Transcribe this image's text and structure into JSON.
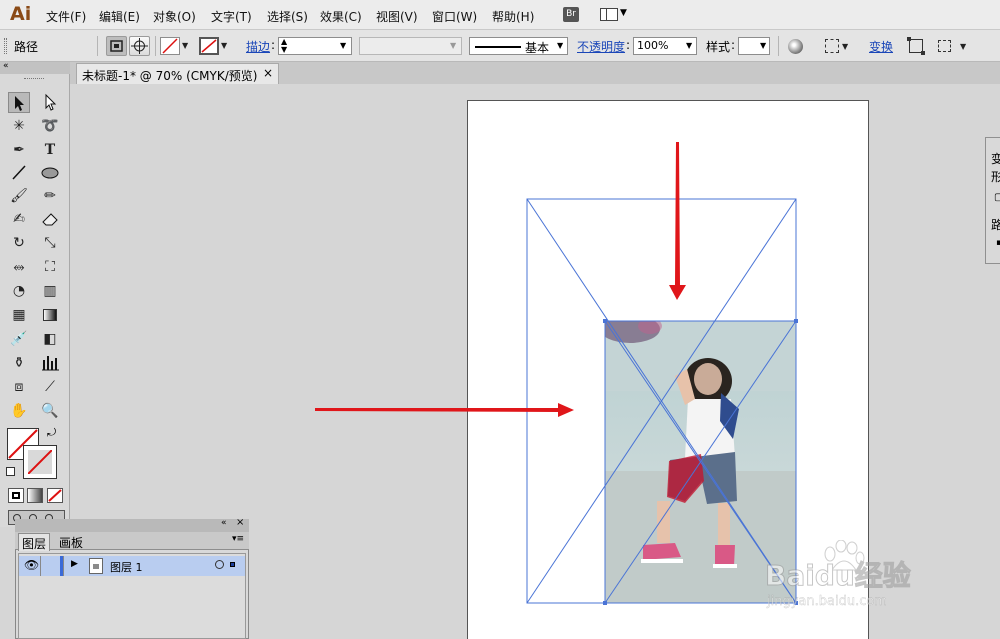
{
  "app": {
    "logo": "Ai"
  },
  "menu": [
    "文件(F)",
    "编辑(E)",
    "对象(O)",
    "文字(T)",
    "选择(S)",
    "效果(C)",
    "视图(V)",
    "窗口(W)",
    "帮助(H)"
  ],
  "menu_extras": {
    "bridge": "Br"
  },
  "control_bar": {
    "selection_label": "路径",
    "stroke_label": "描边",
    "brush_label": "基本",
    "opacity_label": "不透明度",
    "opacity_value": "100%",
    "style_label": "样式",
    "transform_label": "变换"
  },
  "document_tab": {
    "title": "未标题-1* @ 70% (CMYK/预览)",
    "close": "×"
  },
  "tools": [
    "selection-tool",
    "direct-selection-tool",
    "magic-wand-tool",
    "lasso-tool",
    "pen-tool",
    "type-tool",
    "line-tool",
    "ellipse-tool",
    "paintbrush-tool",
    "pencil-tool",
    "blob-brush-tool",
    "eraser-tool",
    "rotate-tool",
    "scale-tool",
    "width-tool",
    "free-transform-tool",
    "shape-builder-tool",
    "perspective-grid-tool",
    "mesh-tool",
    "gradient-tool",
    "eyedropper-tool",
    "blend-tool",
    "symbol-sprayer-tool",
    "column-graph-tool",
    "artboard-tool",
    "slice-tool",
    "hand-tool",
    "zoom-tool"
  ],
  "layers_panel": {
    "tabs": [
      "图层",
      "画板"
    ],
    "layer_name": "图层 1"
  },
  "right_panel": {
    "chars": [
      "变",
      "形",
      "路"
    ]
  },
  "watermark": {
    "brand": "Baidu经验",
    "url": "jingyan.baidu.com"
  },
  "colors": {
    "arrow": "#e0161a",
    "selection": "#4a74d6",
    "layer_highlight": "#b9cdf0",
    "accent_link": "#1a46b8"
  }
}
